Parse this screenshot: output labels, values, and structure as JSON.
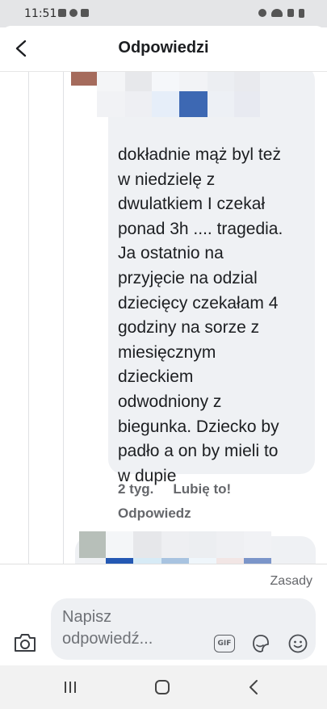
{
  "status_bar": {
    "time": "11:51",
    "left_icons": [
      "gallery-icon",
      "messenger-icon",
      "youtube-icon"
    ],
    "right_icons": [
      "alarm-icon",
      "wifi-icon",
      "signal-icon",
      "battery-icon"
    ]
  },
  "header": {
    "title": "Odpowiedzi",
    "back_icon": "back-arrow-icon"
  },
  "comment": {
    "text": "dokładnie mąż byl też\nw niedzielę z\ndwulatkiem I czekał\nponad 3h .... tragedia.\nJa ostatnio na\nprzyjęcie na odzial\ndziecięcy czekałam 4\ngodziny na sorze z\nmiesięcznym\ndzieckiem\nodwodniony z\nbiegunka.  Dziecko by\npadło a on by mieli to\nw dupie",
    "time_ago": "2 tyg.",
    "like_label": "Lubię to!",
    "reply_label": "Odpowiedz"
  },
  "composer": {
    "rules_label": "Zasady",
    "placeholder": "Napisz odpowiedź...",
    "value": "",
    "icons": [
      "camera-icon",
      "gif-icon",
      "sticker-icon",
      "emoji-icon"
    ]
  },
  "nav_bar": {
    "icons": [
      "recent-apps-icon",
      "home-icon",
      "back-icon"
    ]
  },
  "colors": {
    "bubble_bg": "#eff1f4",
    "meta_text": "#65676b",
    "status_bar_bg": "#e4e5e7",
    "nav_bar_bg": "#f2f2f2"
  }
}
